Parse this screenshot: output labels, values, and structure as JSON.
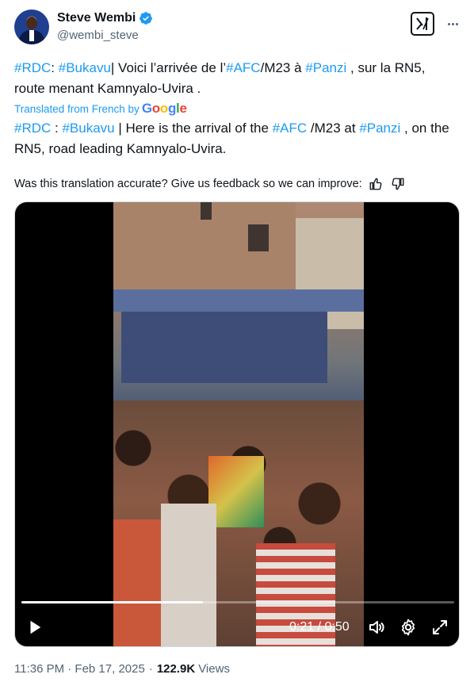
{
  "author": {
    "name": "Steve Wembi",
    "handle": "@wembi_steve"
  },
  "post": {
    "original": {
      "p1": "#RDC",
      "p2": ": ",
      "p3": "#Bukavu",
      "p4": "| Voici l’arrivée de l’",
      "p5": "#AFC",
      "p6": "/M23 à ",
      "p7": "#Panzi",
      "p8": " , sur la RN5, route menant Kamnyalo-Uvira ."
    },
    "translated_label": "Translated from French by",
    "google": [
      "G",
      "o",
      "o",
      "g",
      "l",
      "e"
    ],
    "translation": {
      "p1": "#RDC",
      "p2": " : ",
      "p3": "#Bukavu",
      "p4": " | Here is the arrival of the ",
      "p5": "#AFC",
      "p6": " /M23 at ",
      "p7": "#Panzi",
      "p8": " , on the RN5, road leading Kamnyalo-Uvira."
    },
    "feedback": "Was this translation accurate? Give us feedback so we can improve:"
  },
  "video": {
    "time": "0:21 / 0:50",
    "progress": 0.42
  },
  "meta": {
    "time": "11:36 PM · Feb 17, 2025",
    "sep": "·",
    "views": "122.9K",
    "views_label": "Views"
  },
  "colors": {
    "link": "#1d9bf0",
    "verified": "#1d9bf0"
  },
  "icons": {
    "verified": "verified-badge-icon",
    "grok": "grok-icon",
    "more": "more-icon",
    "thumbs_up": "thumbs-up-icon",
    "thumbs_down": "thumbs-down-icon",
    "play": "play-icon",
    "volume": "volume-icon",
    "settings": "gear-icon",
    "fullscreen": "expand-icon"
  }
}
